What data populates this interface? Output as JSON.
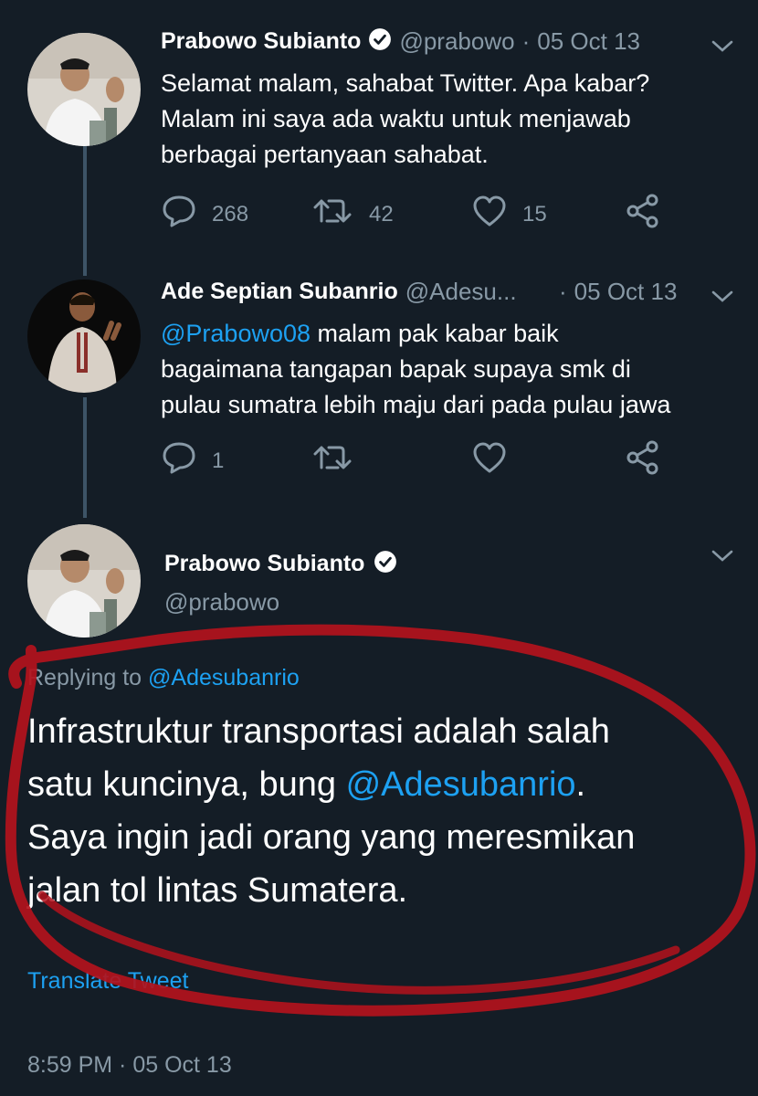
{
  "tweets": [
    {
      "name": "Prabowo Subianto",
      "handle": "@prabowo",
      "separator": "·",
      "date": "05 Oct 13",
      "lines": [
        "Selamat malam, sahabat Twitter. Apa kabar?",
        "Malam ini saya ada waktu untuk menjawab",
        "berbagai pertanyaan sahabat."
      ],
      "replies": "268",
      "retweets": "42",
      "likes": "15"
    },
    {
      "name": "Ade Septian Subanrio",
      "handle": "@Adesu...",
      "separator": "·",
      "date": "05 Oct 13",
      "mention": "@Prabowo08",
      "line1_rest": " malam pak kabar baik",
      "line2": "bagaimana tangapan bapak supaya smk di",
      "line3": "pulau sumatra lebih maju dari  pada pulau  jawa",
      "replies": "1"
    }
  ],
  "main_tweet": {
    "name": "Prabowo Subianto",
    "handle": "@prabowo",
    "replying_prefix": "Replying to ",
    "replying_handle": "@Adesubanrio",
    "line1": "Infrastruktur transportasi adalah salah",
    "line2_pre": "satu kuncinya, bung ",
    "line2_mention": "@Adesubanrio",
    "line2_post": ".",
    "line3": "Saya ingin jadi orang yang meresmikan",
    "line4": "jalan tol lintas Sumatera.",
    "translate": "Translate Tweet",
    "timestamp": "8:59 PM · 05 Oct 13"
  },
  "colors": {
    "background": "#141d26",
    "accent": "#1da1f2",
    "muted": "#8899a6",
    "annotation": "#b3121c"
  },
  "icons": [
    "reply-icon",
    "retweet-icon",
    "like-icon",
    "share-icon",
    "verified-icon",
    "chevron-down-icon"
  ]
}
